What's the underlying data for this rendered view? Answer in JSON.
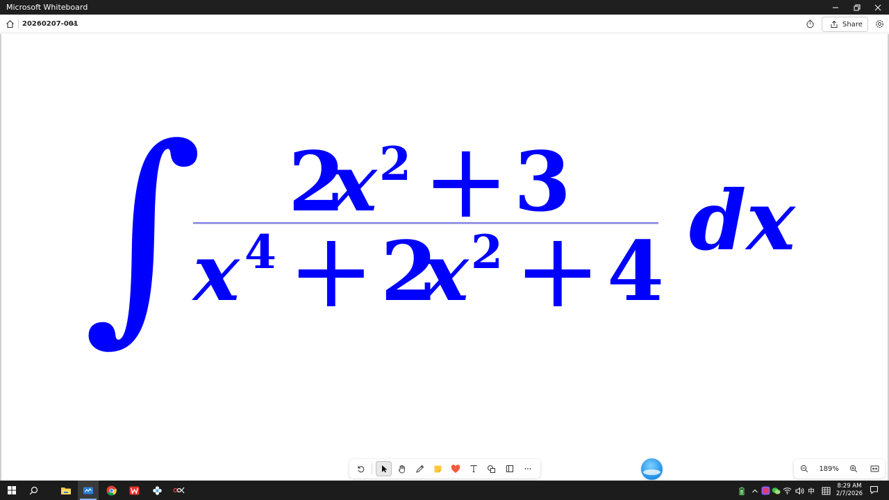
{
  "window": {
    "title": "Microsoft Whiteboard"
  },
  "appbar": {
    "board_name": "20260207-001",
    "share_label": "Share"
  },
  "canvas": {
    "ink_color": "#0000ff",
    "fraction_bar_color": "#8080e0",
    "formula": {
      "integral_sign": "∫",
      "numerator": {
        "coef": "2",
        "var": "x",
        "exp": "2",
        "plus": "+",
        "const": "3"
      },
      "denominator": {
        "var1": "x",
        "exp1": "4",
        "plus1": "+",
        "coef2": "2",
        "var2": "x",
        "exp2": "2",
        "plus2": "+",
        "const": "4"
      },
      "differential": "dx"
    }
  },
  "zoom": {
    "level": "189%"
  },
  "taskbar": {
    "ime": "中",
    "time": "8:29 AM",
    "date": "2/7/2026"
  }
}
